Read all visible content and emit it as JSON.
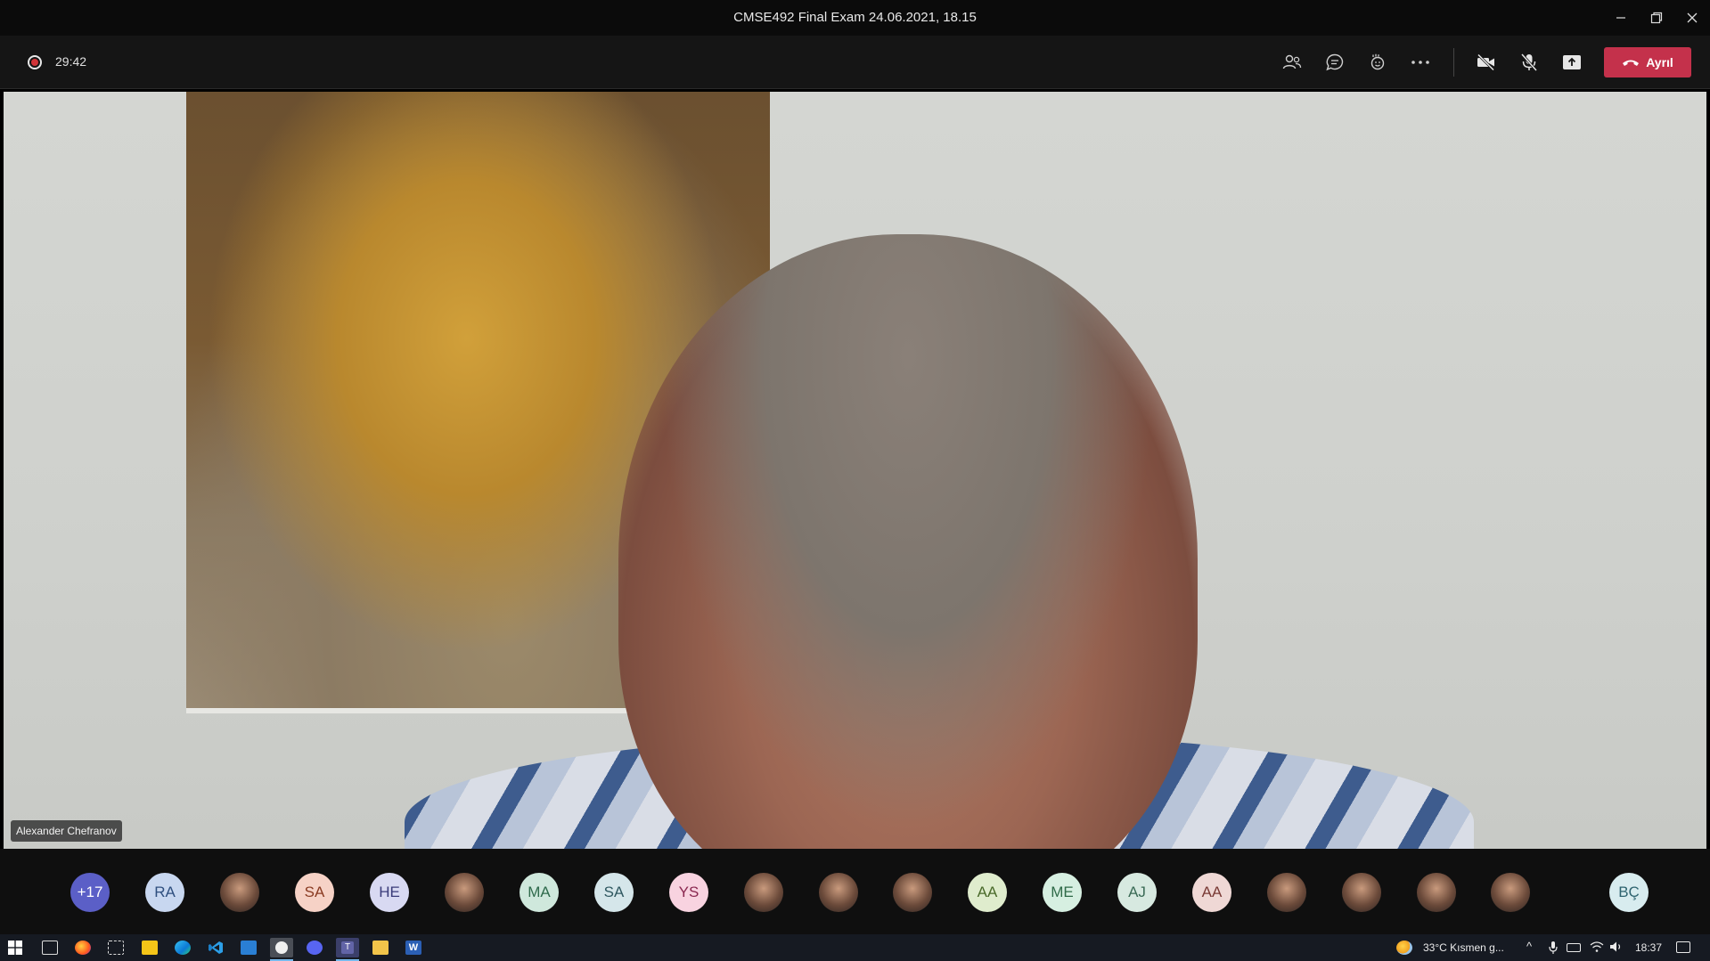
{
  "window": {
    "title": "CMSE492 Final Exam 24.06.2021, 18.15"
  },
  "toolbar": {
    "timer": "29:42",
    "leave_label": "Ayrıl"
  },
  "stage": {
    "speaker_name": "Alexander Chefranov"
  },
  "participants": [
    {
      "initials": "+17",
      "color": "#5b5fc7",
      "text_color": "#ffffff"
    },
    {
      "initials": "RA",
      "color": "#c8d7f0",
      "text_color": "#2f4f7f"
    },
    {
      "initials": "",
      "photo": true
    },
    {
      "initials": "SA",
      "color": "#f6d2c6",
      "text_color": "#8a3b22"
    },
    {
      "initials": "HE",
      "color": "#d8d9f2",
      "text_color": "#3a3c7a"
    },
    {
      "initials": "",
      "photo": true
    },
    {
      "initials": "MA",
      "color": "#cfe8dc",
      "text_color": "#2f6b4c"
    },
    {
      "initials": "SA",
      "color": "#d5e6ea",
      "text_color": "#2f5860"
    },
    {
      "initials": "YS",
      "color": "#f8d3e0",
      "text_color": "#8a2850"
    },
    {
      "initials": "",
      "photo": true
    },
    {
      "initials": "",
      "photo": true
    },
    {
      "initials": "",
      "photo": true
    },
    {
      "initials": "AA",
      "color": "#dfeccd",
      "text_color": "#4a6a2a"
    },
    {
      "initials": "ME",
      "color": "#d6efe1",
      "text_color": "#2f6a48"
    },
    {
      "initials": "AJ",
      "color": "#d7e9e0",
      "text_color": "#3a6a55"
    },
    {
      "initials": "AA",
      "color": "#efd8d5",
      "text_color": "#7a3a35"
    },
    {
      "initials": "",
      "photo": true
    },
    {
      "initials": "",
      "photo": true
    },
    {
      "initials": "",
      "photo": true
    },
    {
      "initials": "",
      "photo": true
    },
    {
      "initials": "BÇ",
      "color": "#d8ecef",
      "text_color": "#2f6470"
    }
  ],
  "taskbar": {
    "weather": "33°C  Kısmen g...",
    "clock": "18:37"
  }
}
